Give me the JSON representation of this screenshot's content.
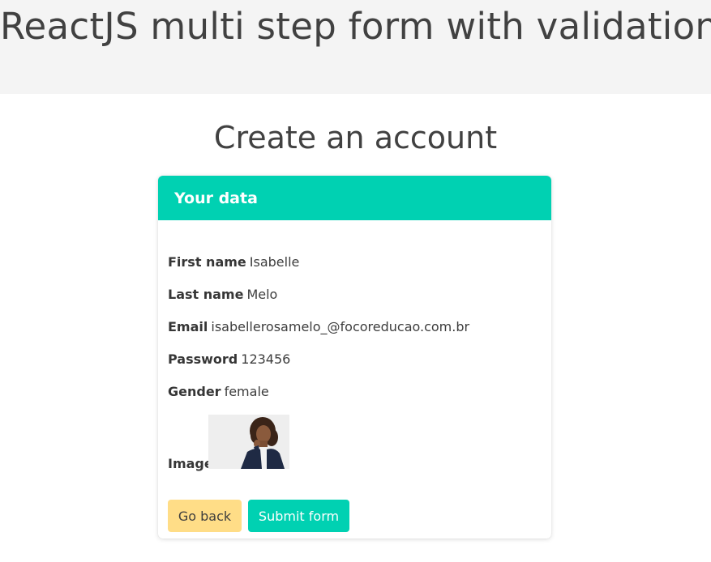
{
  "header": {
    "title": "ReactJS multi step form with validation"
  },
  "page": {
    "subtitle": "Create an account"
  },
  "card": {
    "title": "Your data",
    "fields": {
      "first_name": {
        "label": "First name",
        "value": "Isabelle"
      },
      "last_name": {
        "label": "Last name",
        "value": "Melo"
      },
      "email": {
        "label": "Email",
        "value": "isabellerosamelo_@focoreducao.com.br"
      },
      "password": {
        "label": "Password",
        "value": "123456"
      },
      "gender": {
        "label": "Gender",
        "value": "female"
      },
      "image": {
        "label": "Image"
      }
    },
    "buttons": {
      "back": "Go back",
      "submit": "Submit form"
    }
  },
  "colors": {
    "primary": "#00d1b2",
    "warning": "#ffdd87",
    "header_bg": "#f4f4f4"
  }
}
